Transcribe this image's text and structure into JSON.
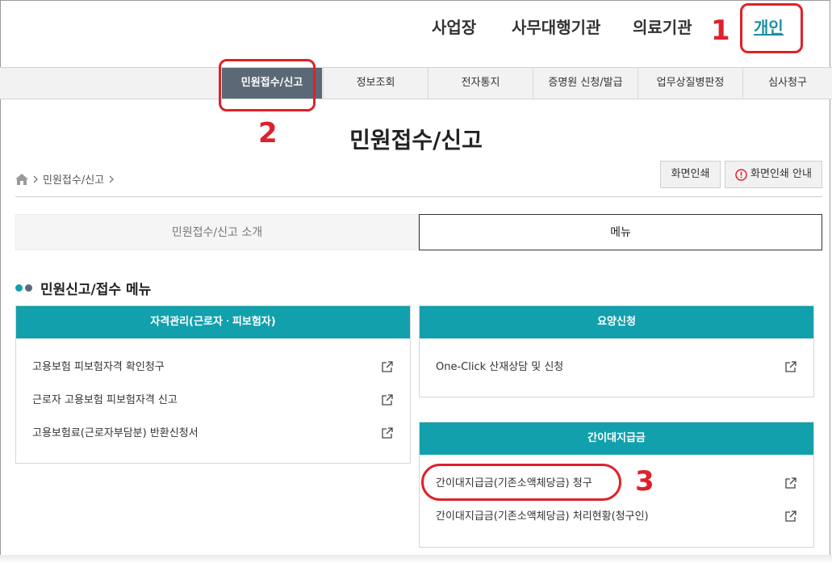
{
  "top_nav": {
    "items": [
      "사업장",
      "사무대행기관",
      "의료기관",
      "개인"
    ]
  },
  "annotations": {
    "step1": "1",
    "step2": "2",
    "step3": "3"
  },
  "main_menu": {
    "items": [
      "민원접수/신고",
      "정보조회",
      "전자통지",
      "증명원 신청/발급",
      "업무상질병판정",
      "심사청구"
    ]
  },
  "page_title": "민원접수/신고",
  "breadcrumb": {
    "current": "민원접수/신고",
    "home_icon": "home-icon",
    "separator_icon": "chevron-right-icon"
  },
  "print_buttons": {
    "print": "화면인쇄",
    "print_guide": "화면인쇄 안내"
  },
  "tabs": {
    "intro": "민원접수/신고 소개",
    "menu": "메뉴"
  },
  "section_title": "민원신고/접수 메뉴",
  "colors": {
    "accent": "#12a0ad",
    "menu_active": "#5b6977",
    "annotation": "#e0202a",
    "link_active": "#1f8fa0"
  },
  "cards": {
    "qualification": {
      "title": "자격관리(근로자ㆍ피보험자)",
      "items": [
        "고용보험 피보험자격 확인청구",
        "근로자 고용보험 피보험자격 신고",
        "고용보험료(근로자부담분) 반환신청서"
      ]
    },
    "care": {
      "title": "요양신청",
      "items": [
        "One-Click 산재상담 및 신청"
      ]
    },
    "advance": {
      "title": "간이대지급금",
      "items": [
        "간이대지급금(기존소액체당금) 청구",
        "간이대지급금(기존소액체당금) 처리현황(청구인)"
      ]
    }
  }
}
